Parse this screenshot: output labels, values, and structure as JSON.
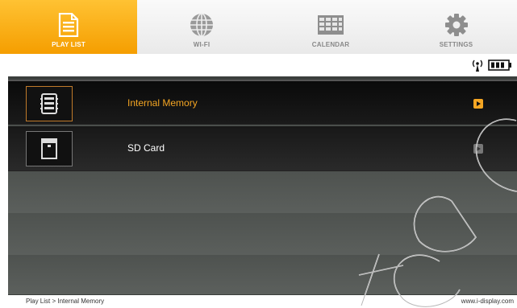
{
  "tabs": [
    {
      "label": "PLAY LIST",
      "icon": "playlist-icon",
      "active": true
    },
    {
      "label": "WI-FI",
      "icon": "globe-icon",
      "active": false
    },
    {
      "label": "CALENDAR",
      "icon": "calendar-icon",
      "active": false
    },
    {
      "label": "SETTINGS",
      "icon": "gear-icon",
      "active": false
    }
  ],
  "status": {
    "signal_icon": "signal-icon",
    "battery_icon": "battery-icon"
  },
  "list": {
    "items": [
      {
        "label": "Internal Memory",
        "icon": "memory-icon",
        "selected": true
      },
      {
        "label": "SD Card",
        "icon": "sd-card-icon",
        "selected": false
      }
    ]
  },
  "footer": {
    "breadcrumb": "Play List > Internal Memory",
    "site": "www.i-display.com"
  },
  "colors": {
    "accent": "#f5a623",
    "tab_active": "#ffb219"
  }
}
